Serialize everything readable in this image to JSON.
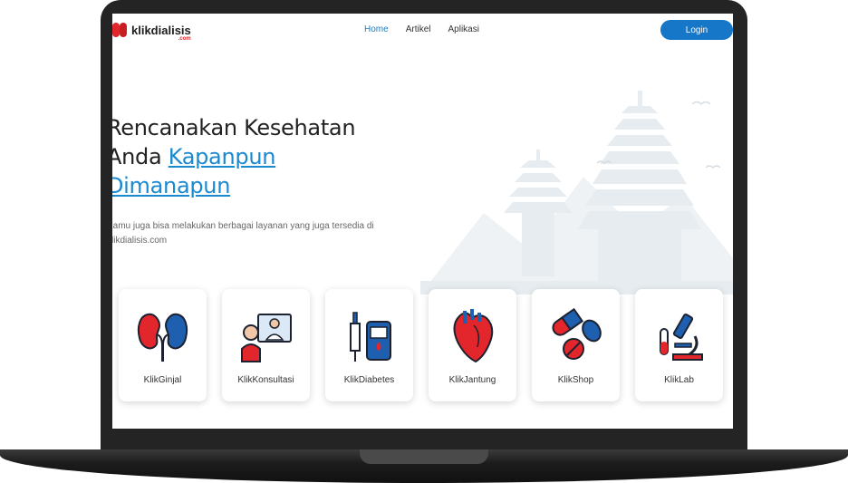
{
  "brand": {
    "name": "klikdialisis",
    "suffix": ".com"
  },
  "nav": {
    "items": [
      {
        "label": "Home",
        "active": true
      },
      {
        "label": "Artikel",
        "active": false
      },
      {
        "label": "Aplikasi",
        "active": false
      }
    ],
    "login_label": "Login"
  },
  "hero": {
    "line1": "Rencanakan Kesehatan",
    "line2_prefix": "Anda ",
    "link1": "Kapanpun",
    "link2": "Dimanapun",
    "subtitle": "Kamu juga bisa melakukan berbagai layanan yang juga tersedia di klikdialisis.com"
  },
  "services": [
    {
      "label": "KlikGinjal",
      "icon": "kidney-icon"
    },
    {
      "label": "KlikKonsultasi",
      "icon": "doctor-consultation-icon"
    },
    {
      "label": "KlikDiabetes",
      "icon": "glucose-meter-icon"
    },
    {
      "label": "KlikJantung",
      "icon": "heart-icon"
    },
    {
      "label": "KlikShop",
      "icon": "pills-icon"
    },
    {
      "label": "KlikLab",
      "icon": "microscope-icon"
    }
  ],
  "colors": {
    "accent": "#1677c8",
    "link": "#1a8ad0",
    "brand_red": "#e3262b"
  }
}
